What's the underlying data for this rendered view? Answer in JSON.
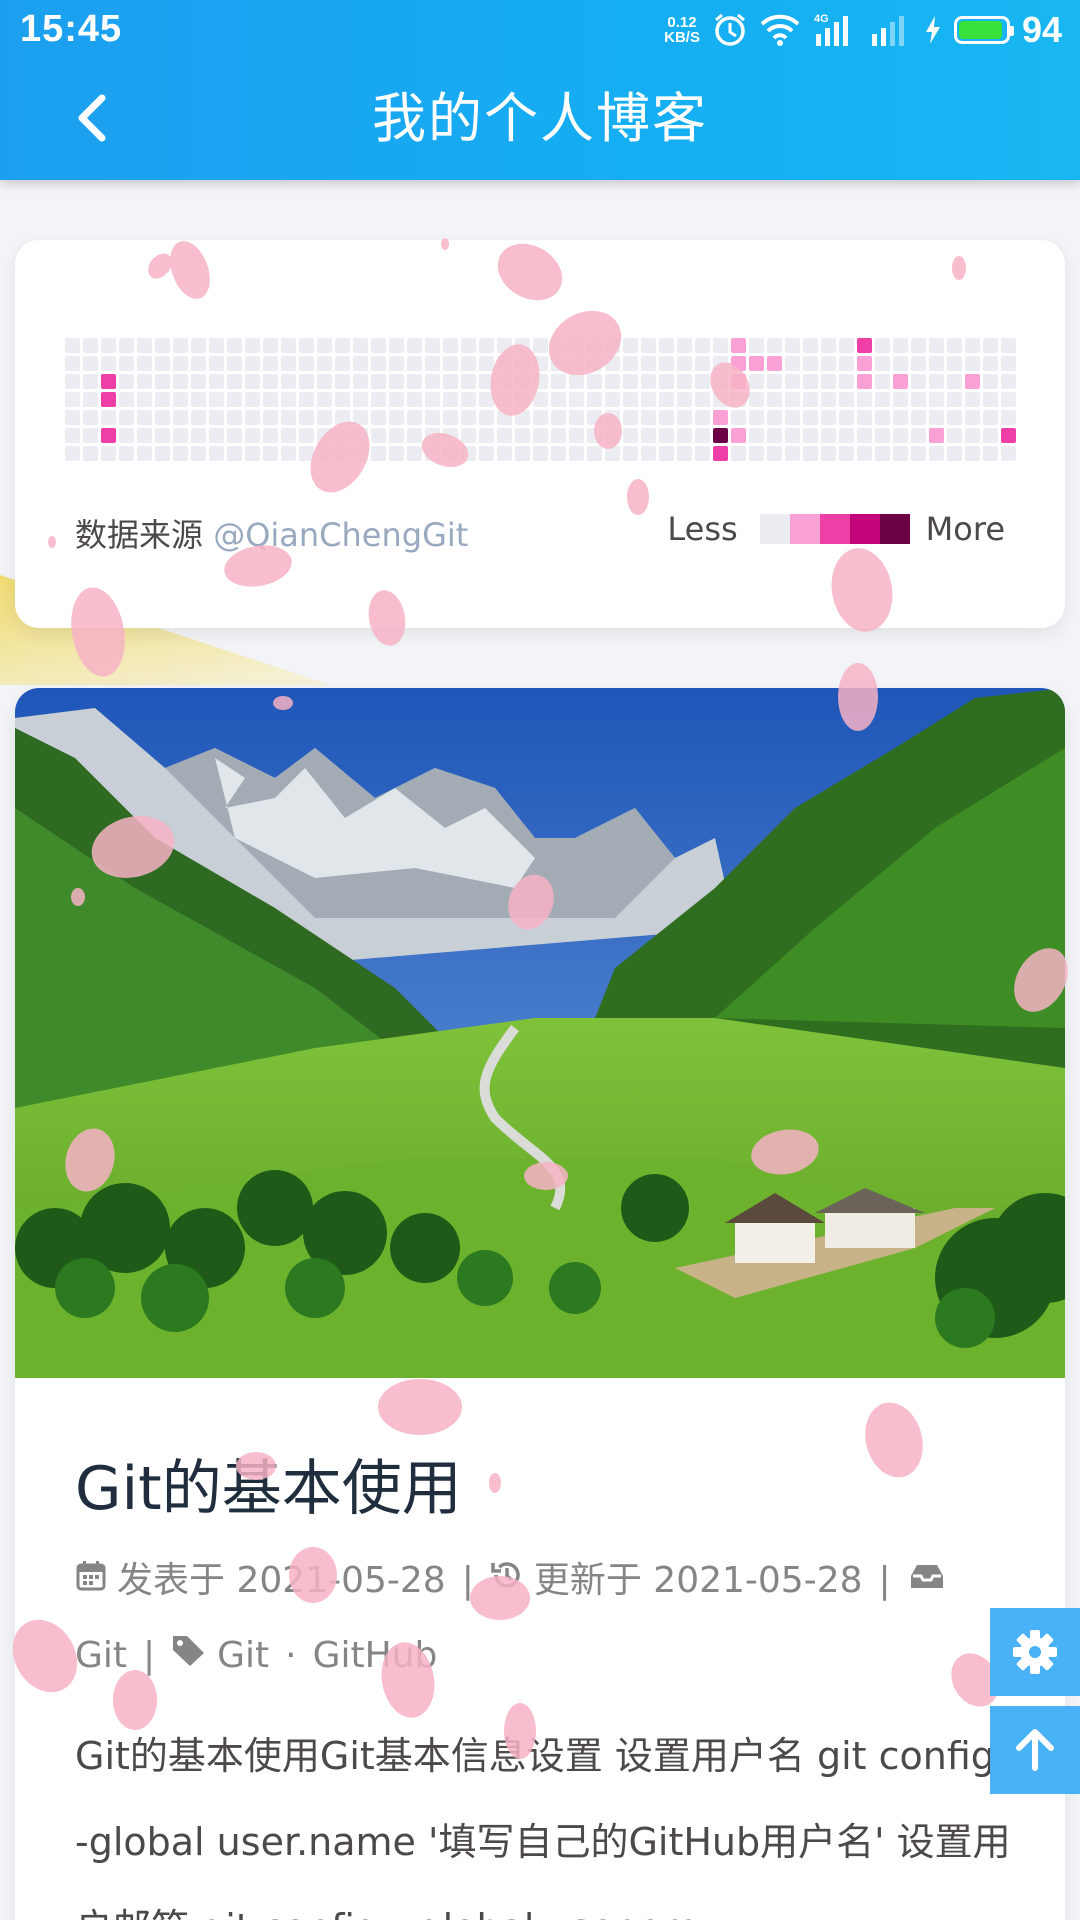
{
  "status_bar": {
    "time": "15:45",
    "net_speed_value": "0.12",
    "net_speed_unit": "KB/S",
    "network_type": "4G",
    "battery_level": 94,
    "battery_text": "94",
    "icons": [
      "alarm-icon",
      "wifi-icon",
      "signal-icon",
      "signal-icon",
      "charging-icon",
      "battery-icon"
    ]
  },
  "header": {
    "title": "我的个人博客",
    "back_icon": "chevron-left-icon"
  },
  "contribution": {
    "source_label": "数据来源 ",
    "source_user": "@QianChengGit",
    "legend_less": "Less",
    "legend_more": "More",
    "legend_colors": [
      "#ebedf2",
      "#f9a0d4",
      "#ee3fa7",
      "#c2037a",
      "#6b0044"
    ],
    "weeks": 53,
    "days": 7,
    "active_cells": [
      {
        "week": 2,
        "day": 2,
        "level": 2
      },
      {
        "week": 2,
        "day": 3,
        "level": 2
      },
      {
        "week": 2,
        "day": 5,
        "level": 2
      },
      {
        "week": 36,
        "day": 4,
        "level": 1
      },
      {
        "week": 36,
        "day": 5,
        "level": 4
      },
      {
        "week": 36,
        "day": 6,
        "level": 2
      },
      {
        "week": 37,
        "day": 0,
        "level": 1
      },
      {
        "week": 37,
        "day": 1,
        "level": 1
      },
      {
        "week": 37,
        "day": 2,
        "level": 1
      },
      {
        "week": 37,
        "day": 5,
        "level": 1
      },
      {
        "week": 38,
        "day": 1,
        "level": 1
      },
      {
        "week": 39,
        "day": 1,
        "level": 1
      },
      {
        "week": 44,
        "day": 0,
        "level": 2
      },
      {
        "week": 44,
        "day": 1,
        "level": 1
      },
      {
        "week": 44,
        "day": 2,
        "level": 1
      },
      {
        "week": 46,
        "day": 2,
        "level": 1
      },
      {
        "week": 48,
        "day": 5,
        "level": 1
      },
      {
        "week": 50,
        "day": 2,
        "level": 1
      },
      {
        "week": 52,
        "day": 5,
        "level": 2
      }
    ]
  },
  "post": {
    "title": "Git的基本使用",
    "published_label": "发表于",
    "published_date": "2021-05-28",
    "updated_label": "更新于",
    "updated_date": "2021-05-28",
    "category": "Git",
    "tags": [
      "Git",
      "GitHub"
    ],
    "tag_separator": "·",
    "separator": "|",
    "excerpt": "Git的基本使用Git基本信息设置 设置用户名 git config --global user.name '填写自己的GitHub用户名' 设置用户邮箱 git config --global user.em...",
    "icons": [
      "calendar-icon",
      "history-icon",
      "inbox-icon",
      "tags-icon"
    ]
  },
  "side_buttons": {
    "settings_icon": "gear-icon",
    "top_icon": "arrow-up-icon"
  },
  "colors": {
    "header": "#1aa8f2",
    "accent": "#49b1f5",
    "petal": "#f7b6c8",
    "title": "#1f2d3d",
    "meta": "#858585"
  }
}
